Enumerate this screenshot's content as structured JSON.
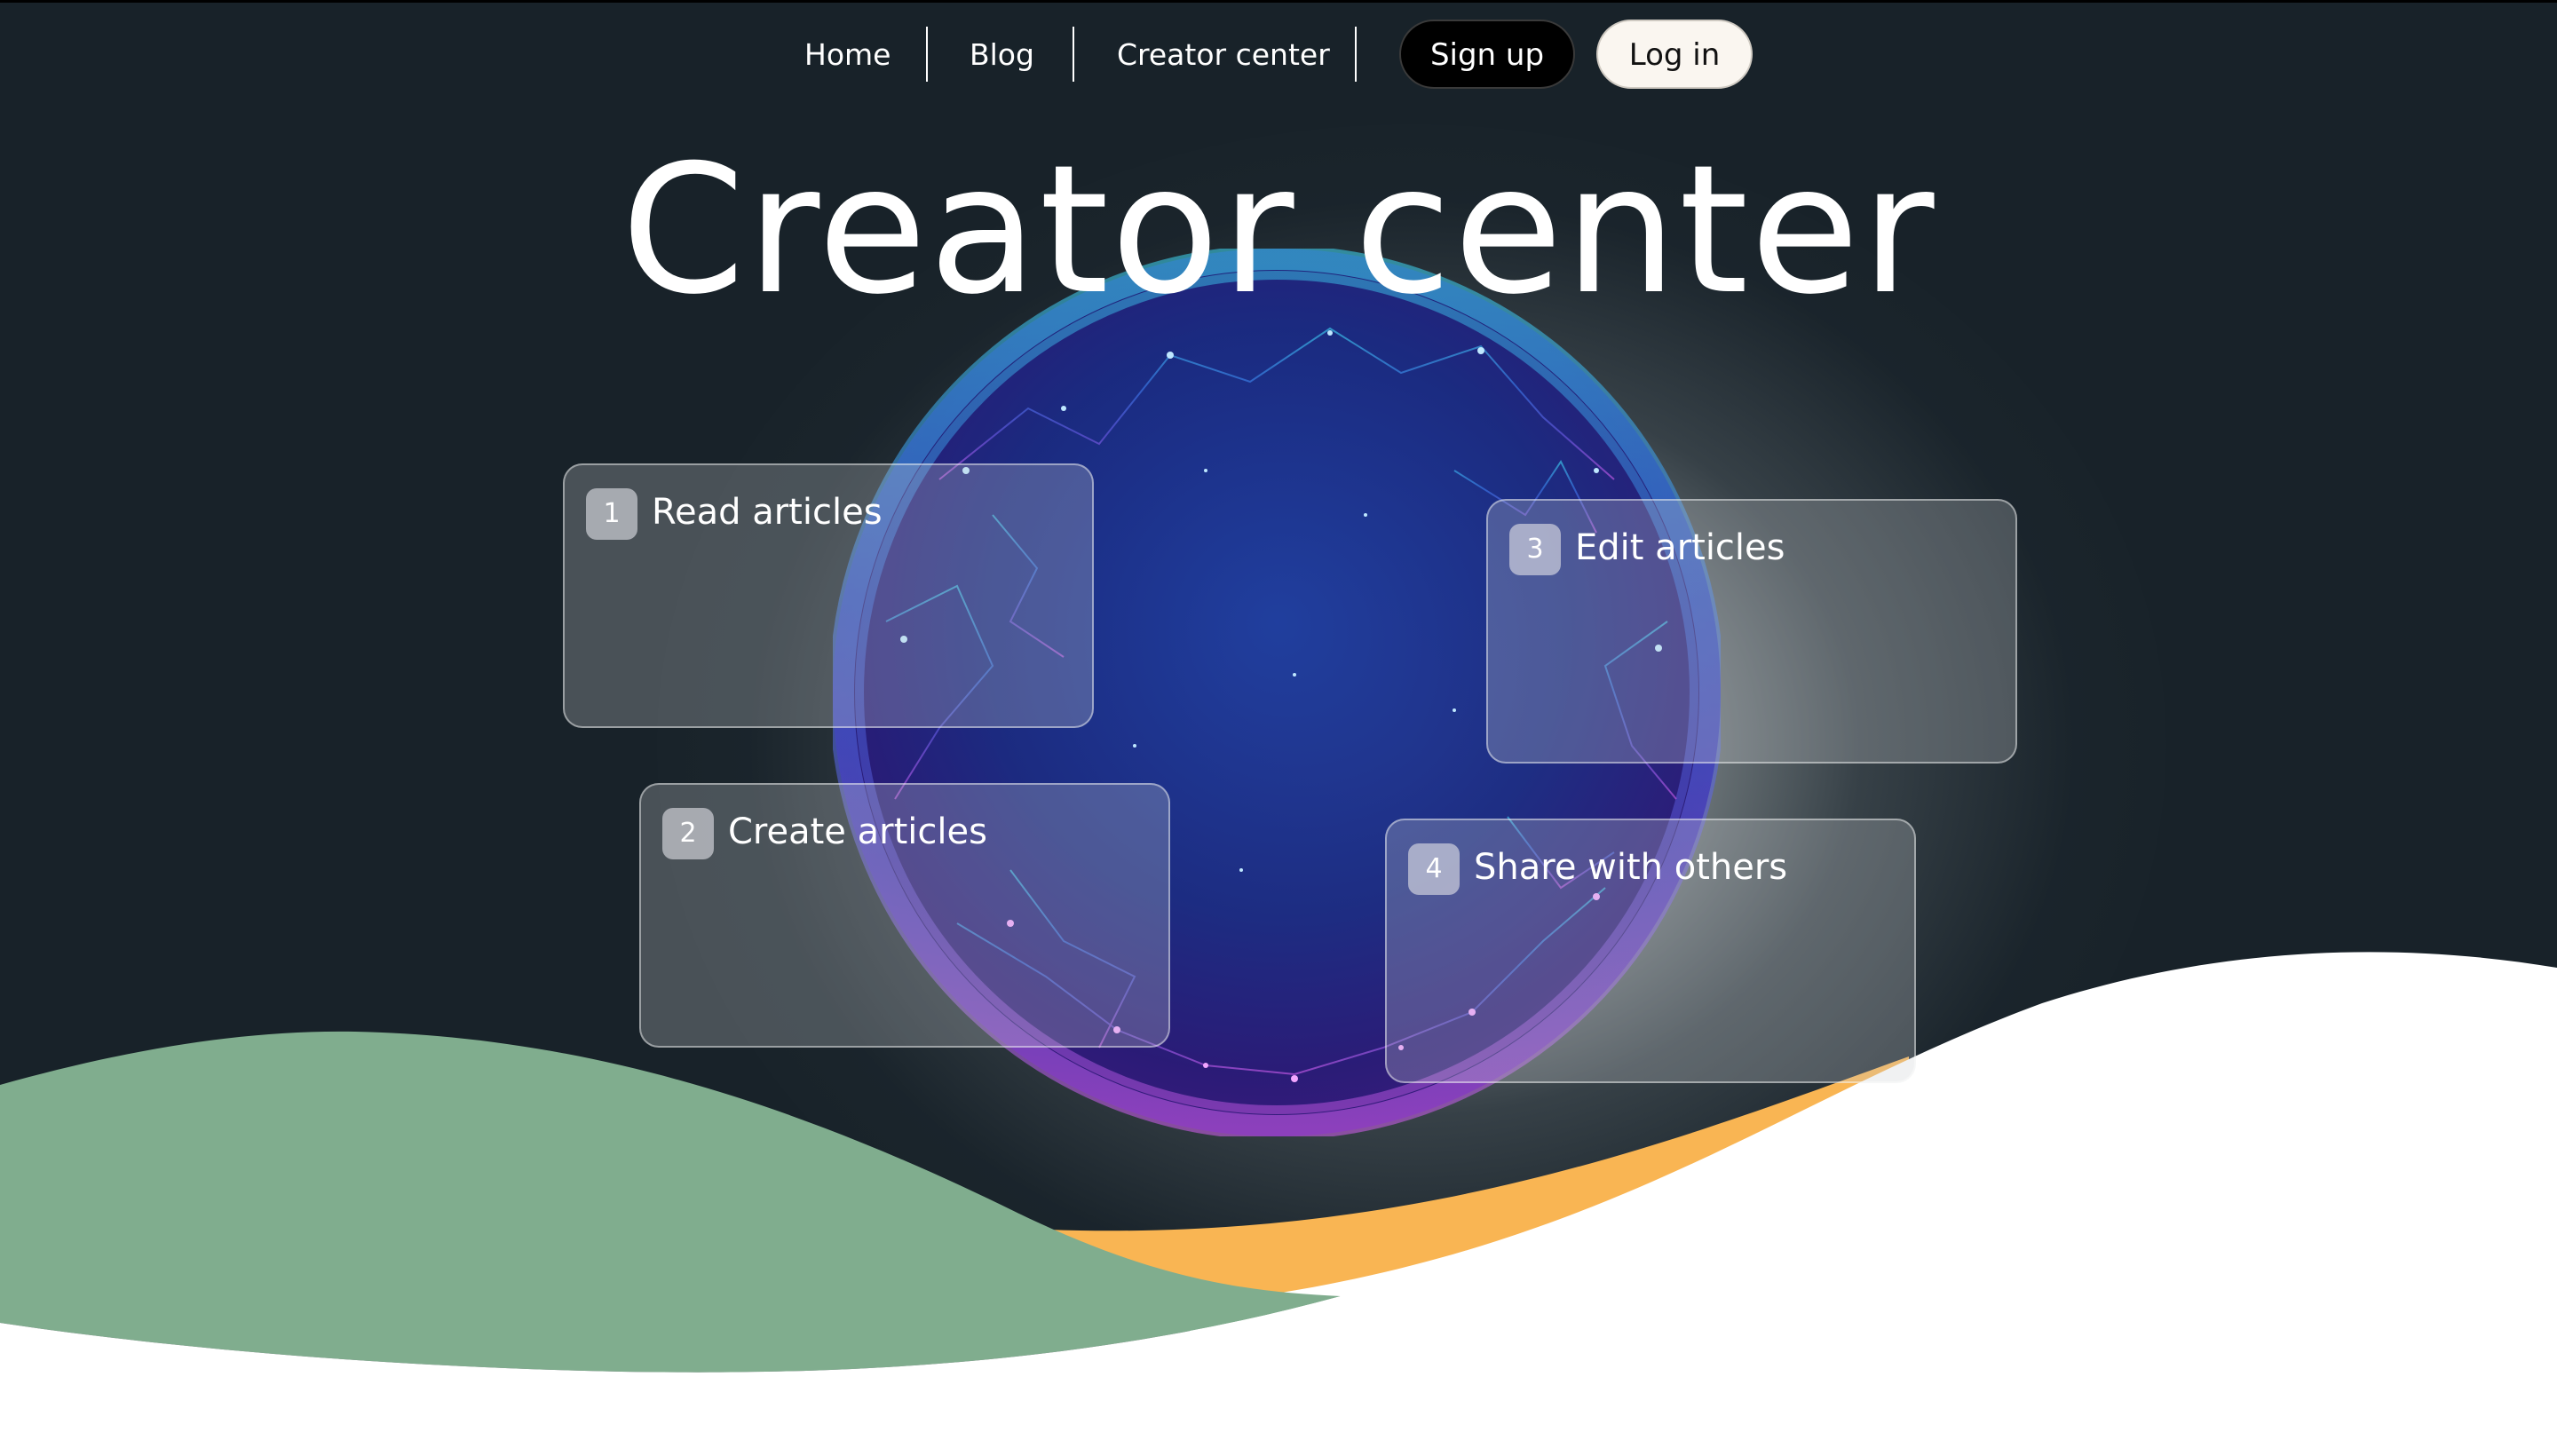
{
  "nav": {
    "links": [
      "Home",
      "Blog",
      "Creator center"
    ],
    "signup_label": "Sign up",
    "login_label": "Log in"
  },
  "hero": {
    "title": "Creator center"
  },
  "cards": [
    {
      "number": "1",
      "label": "Read articles"
    },
    {
      "number": "2",
      "label": "Create articles"
    },
    {
      "number": "3",
      "label": "Edit articles"
    },
    {
      "number": "4",
      "label": "Share with others"
    }
  ],
  "colors": {
    "background": "#182229",
    "wave_green": "#80ad8e",
    "wave_orange": "#f9b553",
    "wave_white": "#ffffff",
    "sphere_cyan": "#3ad8f5",
    "sphere_blue": "#1e3bb0",
    "sphere_purple": "#c651e8"
  },
  "icons": {
    "sphere": "network-globe-graphic"
  }
}
